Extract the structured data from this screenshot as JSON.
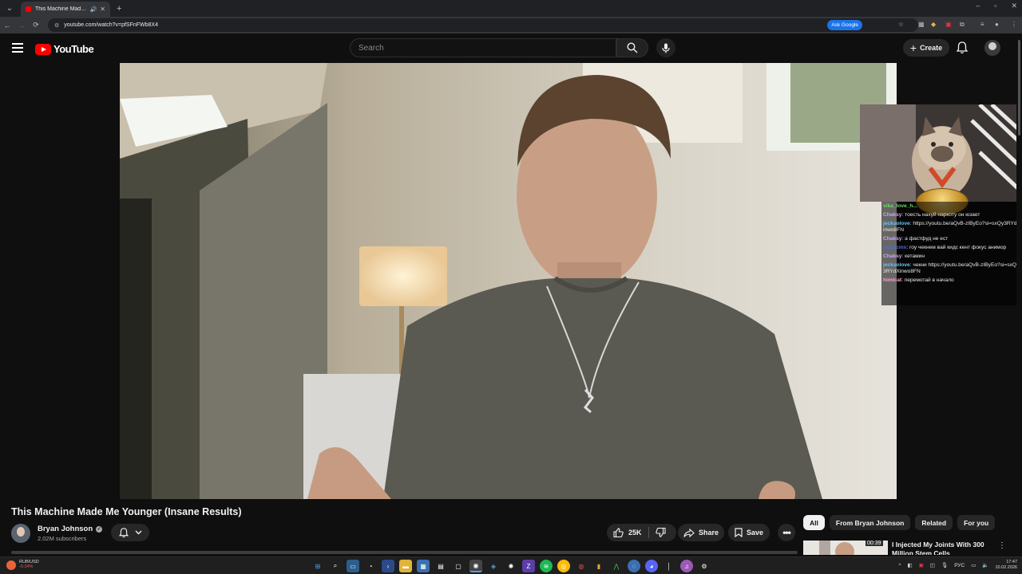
{
  "browser": {
    "tab_title": "This Machine Made Me Yo...",
    "url": "youtube.com/watch?v=pfSFnFWb8X4",
    "ask_google": "Ask Google"
  },
  "header": {
    "logo_text": "YouTube",
    "search_placeholder": "Search",
    "create_label": "Create"
  },
  "video": {
    "title": "This Machine Made Me Younger (Insane Results)",
    "channel_name": "Bryan Johnson",
    "subscribers": "2.02M subscribers",
    "likes": "25K",
    "share_label": "Share",
    "save_label": "Save"
  },
  "overlay_chat": [
    {
      "user": "vika_love_h...",
      "text": "",
      "color": "#6fd46f"
    },
    {
      "user": "Chaksy",
      "text": "тоесть нахуй наркоту он юзает",
      "color": "#c7a6ff"
    },
    {
      "user": "jecksolove",
      "text": "https://youtu.be/aQvB-zIByEo?si=sxQy3RYdXinwo8FN",
      "color": "#5fc6ff"
    },
    {
      "user": "Chaksy",
      "text": "а фастфуд не ест",
      "color": "#c7a6ff"
    },
    {
      "user": "mzzxcmx",
      "text": "гоу чекнем вай кидс кент фокус анимор",
      "color": "#4f6bd8"
    },
    {
      "user": "Chaksy",
      "text": "кетамин",
      "color": "#c7a6ff"
    },
    {
      "user": "jecksolove",
      "text": "чекни https://youtu.be/aQvB-zIByEo?si=sxQy3RYdXinwo8FN",
      "color": "#5fc6ff"
    },
    {
      "user": "himicat",
      "text": "перемотай в начало",
      "color": "#ff9fd0"
    }
  ],
  "chips": [
    "All",
    "From Bryan Johnson",
    "Related",
    "For you"
  ],
  "recommendation": {
    "title": "I Injected My Joints With 300 Million Stem Cells",
    "duration": "00:39"
  },
  "taskbar": {
    "ticker_name": "RUB/USD",
    "ticker_change": "-0.34%",
    "lang": "РУС",
    "time": "17:47",
    "date": "10.02.2026"
  },
  "colors": {
    "youtube_red": "#ff0000",
    "background": "#0f0f0f",
    "chip_active": "#f1f1f1"
  }
}
